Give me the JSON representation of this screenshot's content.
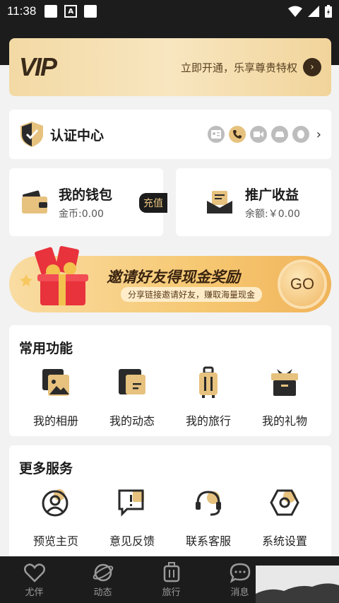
{
  "status_bar": {
    "time": "11:38"
  },
  "vip": {
    "logo": "VIP",
    "promo_text": "立即开通，乐享尊贵特权"
  },
  "certification": {
    "title": "认证中心"
  },
  "wallet": {
    "title": "我的钱包",
    "balance": "金币:0.00",
    "recharge_label": "充值"
  },
  "promotion": {
    "title": "推广收益",
    "balance": "余额:￥0.00"
  },
  "invite": {
    "title": "邀请好友得现金奖励",
    "subtitle": "分享链接邀请好友，赚取海量现金",
    "go_label": "GO"
  },
  "common_functions": {
    "title": "常用功能",
    "items": [
      {
        "label": "我的相册",
        "icon": "album-icon"
      },
      {
        "label": "我的动态",
        "icon": "moments-icon"
      },
      {
        "label": "我的旅行",
        "icon": "luggage-icon"
      },
      {
        "label": "我的礼物",
        "icon": "gift-box-icon"
      }
    ]
  },
  "more_services": {
    "title": "更多服务",
    "items": [
      {
        "label": "预览主页",
        "icon": "profile-icon"
      },
      {
        "label": "意见反馈",
        "icon": "feedback-icon"
      },
      {
        "label": "联系客服",
        "icon": "headset-icon"
      },
      {
        "label": "系统设置",
        "icon": "settings-icon"
      }
    ]
  },
  "tabbar": {
    "items": [
      {
        "label": "尤伴",
        "icon": "heart-icon"
      },
      {
        "label": "动态",
        "icon": "planet-icon"
      },
      {
        "label": "旅行",
        "icon": "suitcase-icon"
      },
      {
        "label": "消息",
        "icon": "chat-icon"
      }
    ]
  },
  "colors": {
    "accent": "#e6c27e",
    "dark": "#1c1c1c"
  }
}
